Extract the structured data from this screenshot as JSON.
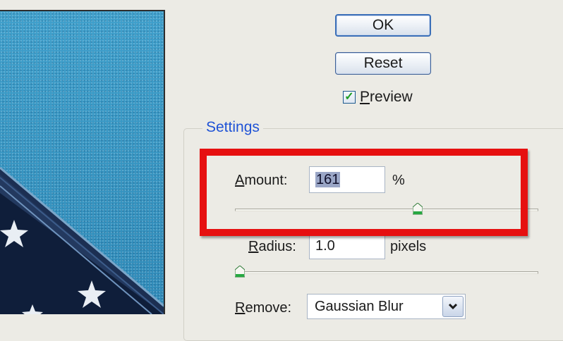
{
  "buttons": {
    "ok_label": "OK",
    "reset_label": "Reset"
  },
  "preview_checkbox": {
    "label_underlined": "P",
    "label_rest": "review",
    "checked": true
  },
  "settings": {
    "title": "Settings",
    "amount": {
      "label_underlined": "A",
      "label_rest": "mount:",
      "value": "161",
      "unit": "%",
      "slider_fraction": 0.63
    },
    "radius": {
      "label_underlined": "R",
      "label_rest": "adius:",
      "value": "1.0",
      "unit": "pixels",
      "slider_fraction": 0.0
    },
    "remove": {
      "label_underlined": "R",
      "label_rest": "emove:",
      "value": "Gaussian Blur"
    }
  },
  "colors": {
    "accent_title": "#1f53d6",
    "highlight_red": "#e61010",
    "preview_sky": "#3a97c4",
    "checkmark": "#1d9c21"
  },
  "icons": [
    "checkmark-icon",
    "chevron-down-icon",
    "slider-thumb-icon",
    "star-icon"
  ]
}
